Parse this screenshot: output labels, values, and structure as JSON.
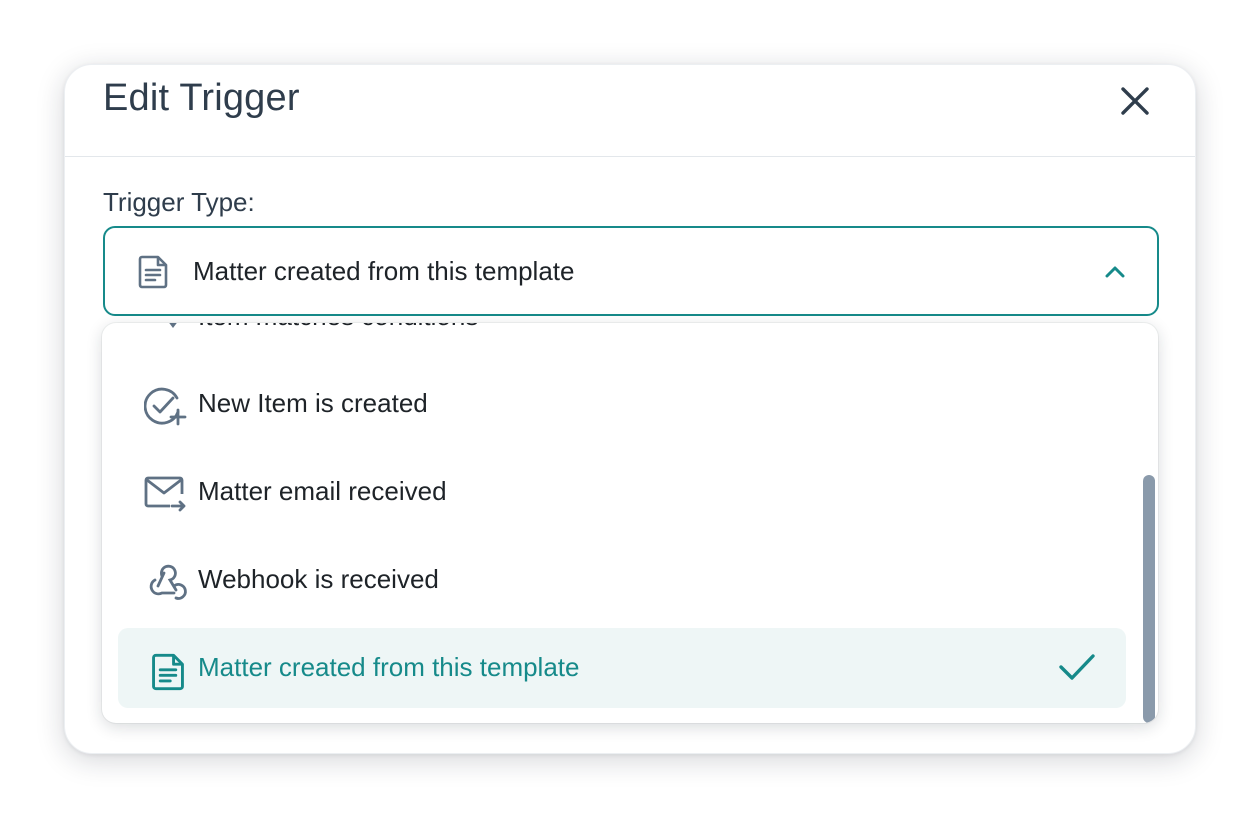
{
  "modal": {
    "title": "Edit Trigger",
    "close_icon": "close-icon"
  },
  "trigger_type": {
    "label": "Trigger Type:",
    "selected_value": "Matter created from this template",
    "selected_icon": "document-icon"
  },
  "dropdown": {
    "partially_visible_item": "Item matches conditions",
    "options": [
      {
        "label": "New Item is created",
        "icon": "check-circle-plus-icon"
      },
      {
        "label": "Matter email received",
        "icon": "mail-forward-icon"
      },
      {
        "label": "Webhook is received",
        "icon": "webhook-icon"
      },
      {
        "label": "Matter created from this template",
        "icon": "document-icon",
        "selected": true
      }
    ]
  },
  "colors": {
    "accent": "#168a8a",
    "text": "#1e2328",
    "icon": "#5f7184",
    "selected_bg": "#eef6f6",
    "scrollbar": "#8a9aab"
  }
}
